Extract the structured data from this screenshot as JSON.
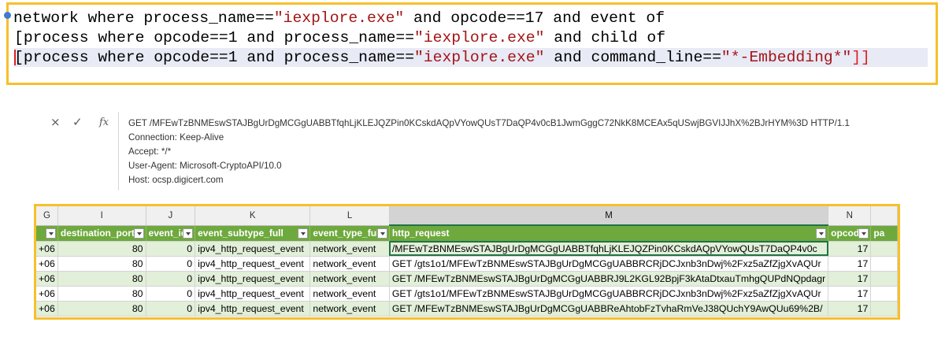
{
  "query": {
    "line1": {
      "kw1": "network where process_name==",
      "str1": "\"iexplore.exe\"",
      "kw2": " and opcode==17 and event of"
    },
    "line2": {
      "kw1": "[process where opcode==1 and process_name==",
      "str1": "\"iexplore.exe\"",
      "kw2": " and child of"
    },
    "line3": {
      "kw1": "[process where opcode==1 and process_name==",
      "str1": "\"iexplore.exe\"",
      "kw2": " and command_line==",
      "str2": "\"*-Embedding*\"",
      "close": "]]"
    }
  },
  "formula_bar": {
    "cancel_icon": "×",
    "enter_icon": "✓",
    "fx_label": "fx",
    "lines": [
      "GET /MFEwTzBNMEswSTAJBgUrDgMCGgUABBTfqhLjKLEJQZPin0KCskdAQpVYowQUsT7DaQP4v0cB1JwmGggC72NkK8MCEAx5qUSwjBGVIJJhX%2BJrHYM%3D HTTP/1.1",
      "Connection: Keep-Alive",
      "Accept: */*",
      "User-Agent: Microsoft-CryptoAPI/10.0",
      "Host: ocsp.digicert.com"
    ]
  },
  "sheet": {
    "column_letters": [
      "G",
      "I",
      "J",
      "K",
      "L",
      "M",
      "N",
      ""
    ],
    "headers": [
      "",
      "destination_port",
      "event_id",
      "event_subtype_full",
      "event_type_full",
      "http_request",
      "opcode",
      "pa"
    ],
    "rows": [
      [
        "+06",
        "80",
        "0",
        "ipv4_http_request_event",
        "network_event",
        "/MFEwTzBNMEswSTAJBgUrDgMCGgUABBTfqhLjKLEJQZPin0KCskdAQpVYowQUsT7DaQP4v0c",
        "17",
        ""
      ],
      [
        "+06",
        "80",
        "0",
        "ipv4_http_request_event",
        "network_event",
        "GET /gts1o1/MFEwTzBNMEswSTAJBgUrDgMCGgUABBRCRjDCJxnb3nDwj%2Fxz5aZfZjgXvAQUr",
        "17",
        ""
      ],
      [
        "+06",
        "80",
        "0",
        "ipv4_http_request_event",
        "network_event",
        "GET /MFEwTzBNMEswSTAJBgUrDgMCGgUABBRJ9L2KGL92BpjF3kAtaDtxauTmhgQUPdNQpdagr",
        "17",
        ""
      ],
      [
        "+06",
        "80",
        "0",
        "ipv4_http_request_event",
        "network_event",
        "GET /gts1o1/MFEwTzBNMEswSTAJBgUrDgMCGgUABBRCRjDCJxnb3nDwj%2Fxz5aZfZjgXvAQUr",
        "17",
        ""
      ],
      [
        "+06",
        "80",
        "0",
        "ipv4_http_request_event",
        "network_event",
        "GET /MFEwTzBNMEswSTAJBgUrDgMCGgUABBReAhtobFzTvhaRmVeJ38QUchY9AwQUu69%2B/",
        "17",
        ""
      ]
    ]
  },
  "colors": {
    "highlight_border": "#f6c02c",
    "header_green": "#6ea93d",
    "band_green": "#e2efd9",
    "selection": "#217346"
  }
}
